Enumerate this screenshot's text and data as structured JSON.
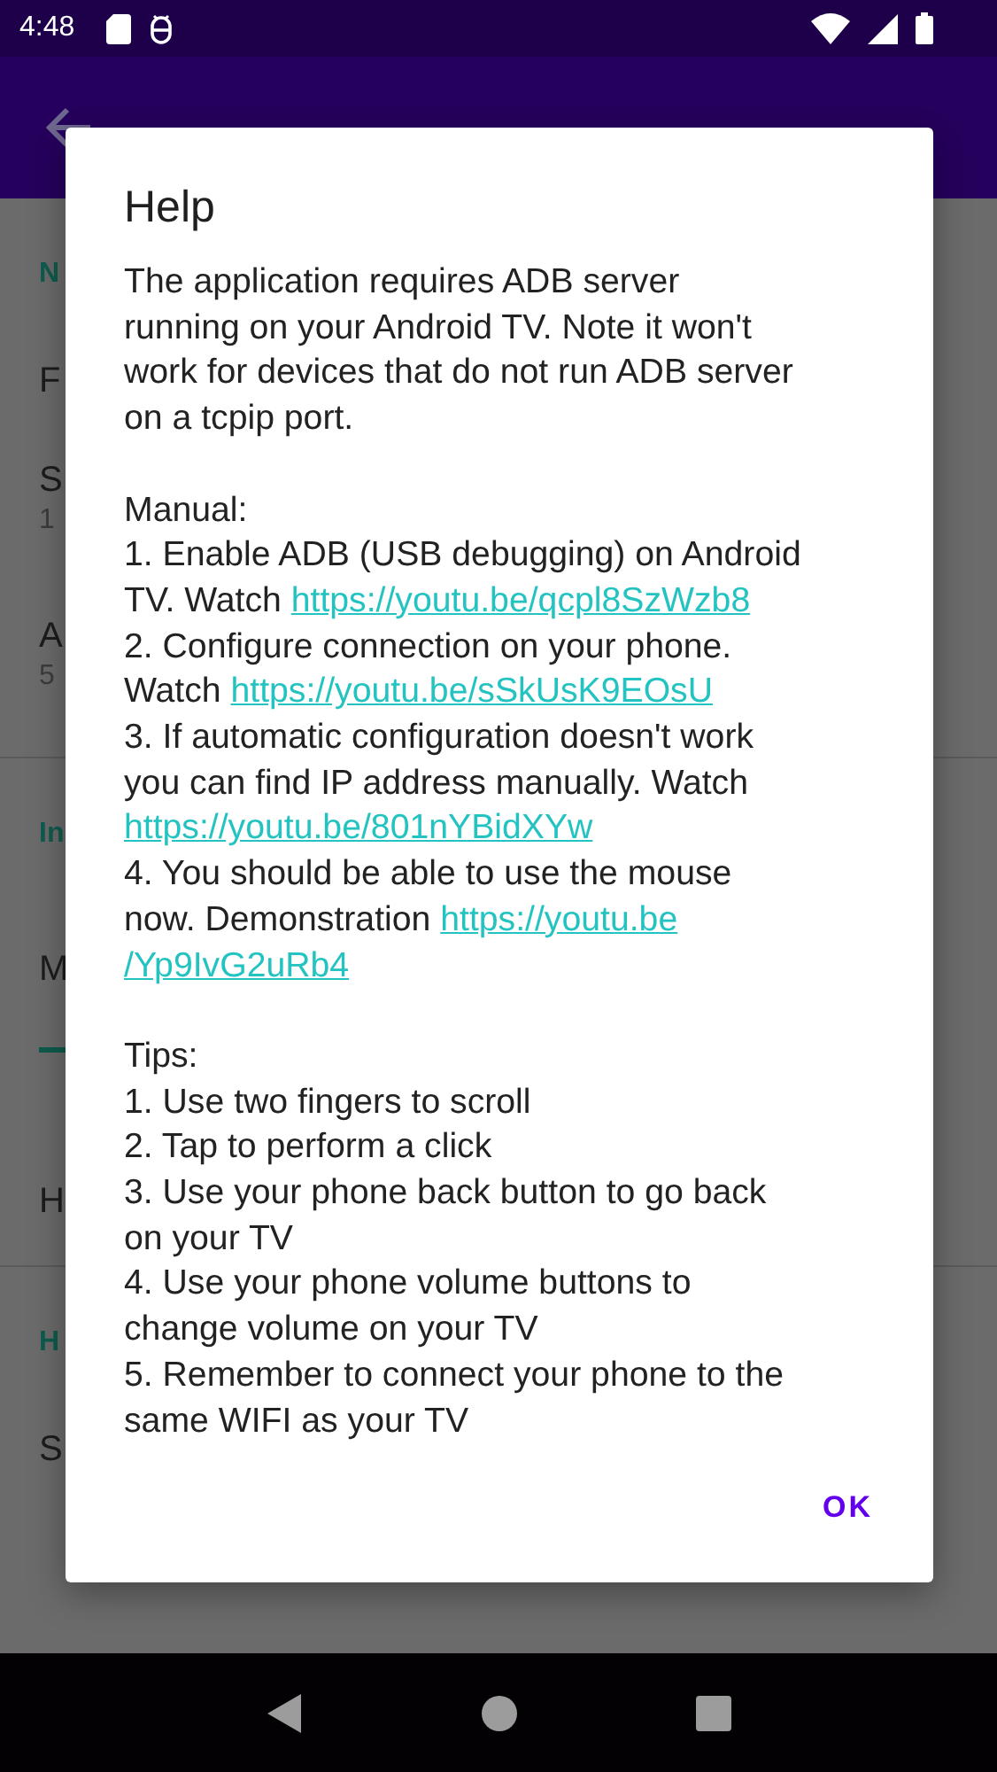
{
  "status_bar": {
    "time": "4:48"
  },
  "app_bar": {
    "back_button": true
  },
  "background_items": [
    {
      "kind": "header",
      "text": "N"
    },
    {
      "kind": "title",
      "text": "F"
    },
    {
      "kind": "twoline",
      "text": "S",
      "sub": "1"
    },
    {
      "kind": "twoline",
      "text": "A",
      "sub": "5"
    },
    {
      "kind": "divider"
    },
    {
      "kind": "header",
      "text": "In"
    },
    {
      "kind": "seekbar",
      "text": "M"
    },
    {
      "kind": "title",
      "text": "H"
    },
    {
      "kind": "divider"
    },
    {
      "kind": "header",
      "text": "H"
    },
    {
      "kind": "title",
      "text": "S"
    }
  ],
  "dialog": {
    "title": "Help",
    "paragraphs": [
      {
        "lines": [
          [
            {
              "text": "The application requires ADB server"
            }
          ],
          [
            {
              "text": "running on your Android TV. Note it won't"
            }
          ],
          [
            {
              "text": "work for devices that do not run ADB server"
            }
          ],
          [
            {
              "text": "on a tcpip port."
            }
          ]
        ]
      },
      {
        "lines": [
          [
            {
              "text": "Manual:"
            }
          ],
          [
            {
              "text": "1. Enable ADB (USB debugging) on Android"
            }
          ],
          [
            {
              "text": "TV. Watch "
            },
            {
              "text": "https://youtu.be/qcpl8SzWzb8",
              "link": true
            }
          ],
          [
            {
              "text": "2. Configure connection on your phone."
            }
          ],
          [
            {
              "text": "Watch "
            },
            {
              "text": "https://youtu.be/sSkUsK9EOsU",
              "link": true
            }
          ],
          [
            {
              "text": "3. If automatic configuration doesn't work"
            }
          ],
          [
            {
              "text": "you can find IP address manually. Watch"
            }
          ],
          [
            {
              "text": "https://youtu.be/801nYBidXYw",
              "link": true
            }
          ],
          [
            {
              "text": "4. You should be able to use the mouse"
            }
          ],
          [
            {
              "text": "now. Demonstration "
            },
            {
              "text": "https://youtu.be",
              "link": true
            }
          ],
          [
            {
              "text": "/Yp9IvG2uRb4",
              "link": true
            }
          ]
        ]
      },
      {
        "lines": [
          [
            {
              "text": "Tips:"
            }
          ],
          [
            {
              "text": "1. Use two fingers to scroll"
            }
          ],
          [
            {
              "text": "2. Tap to perform a click"
            }
          ],
          [
            {
              "text": "3. Use your phone back button to go back"
            }
          ],
          [
            {
              "text": "on your TV"
            }
          ],
          [
            {
              "text": "4. Use your phone volume buttons to"
            }
          ],
          [
            {
              "text": "change volume on your TV"
            }
          ],
          [
            {
              "text": "5. Remember to connect your phone to the"
            }
          ],
          [
            {
              "text": "same WIFI as your TV"
            }
          ]
        ]
      }
    ],
    "button": "OK"
  }
}
